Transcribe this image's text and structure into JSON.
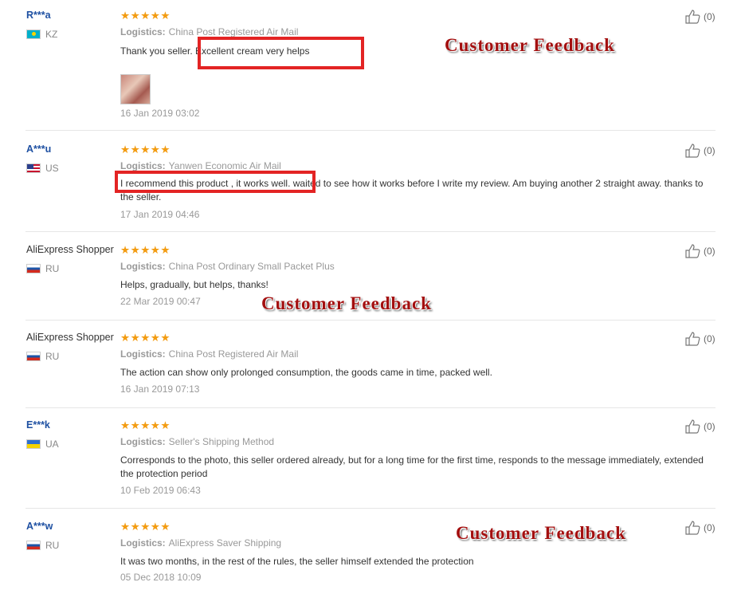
{
  "logistics_label": "Logistics:",
  "stars": "★★★★★",
  "overlay_label": "Customer Feedback",
  "reviews": [
    {
      "user": "R***a",
      "country": "KZ",
      "logistics": "China Post Registered Air Mail",
      "text": "Thank you seller. Excellent cream very helps",
      "date": "16 Jan 2019 03:02",
      "helpful": "(0)",
      "has_photo": true
    },
    {
      "user": "A***u",
      "country": "US",
      "logistics": "Yanwen Economic Air Mail",
      "text": "I recommend this product , it works well.   waited to see how it works before I write my review. Am buying another 2 straight away. thanks to the seller.",
      "date": "17 Jan 2019 04:46",
      "helpful": "(0)"
    },
    {
      "user": "AliExpress Shopper",
      "country": "RU",
      "logistics": "China Post Ordinary Small Packet Plus",
      "text": "Helps, gradually, but helps, thanks!",
      "date": "22 Mar 2019 00:47",
      "helpful": "(0)"
    },
    {
      "user": "AliExpress Shopper",
      "country": "RU",
      "logistics": "China Post Registered Air Mail",
      "text": "The action can show only prolonged consumption, the goods came in time, packed well.",
      "date": "16 Jan 2019 07:13",
      "helpful": "(0)"
    },
    {
      "user": "E***k",
      "country": "UA",
      "logistics": "Seller's Shipping Method",
      "text": "Corresponds to the photo, this seller ordered already, but for a long time for the first time, responds to the message immediately, extended the protection period",
      "date": "10 Feb 2019 06:43",
      "helpful": "(0)"
    },
    {
      "user": "A***w",
      "country": "RU",
      "logistics": "AliExpress Saver Shipping",
      "text": "It was two months, in the rest of the rules, the seller himself extended the protection",
      "date": "05 Dec 2018 10:09",
      "helpful": "(0)"
    }
  ]
}
